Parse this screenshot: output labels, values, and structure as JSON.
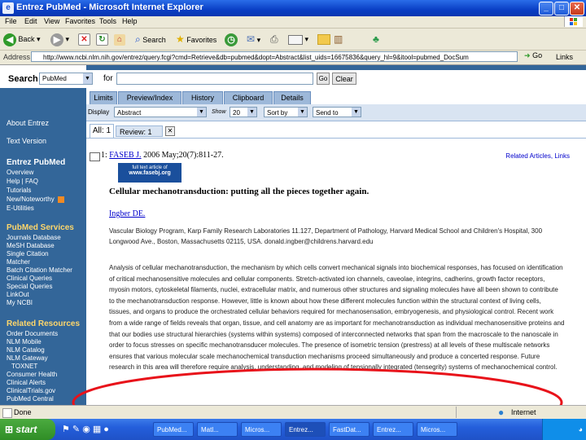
{
  "window": {
    "title": "Entrez PubMed - Microsoft Internet Explorer",
    "minimize": "_",
    "maximize": "□",
    "close": "✕"
  },
  "menu": [
    "File",
    "Edit",
    "View",
    "Favorites",
    "Tools",
    "Help"
  ],
  "toolbar": {
    "back": "Back",
    "search": "Search",
    "favorites": "Favorites"
  },
  "address": {
    "label": "Address",
    "url": "http://www.ncbi.nlm.nih.gov/entrez/query.fcgi?cmd=Retrieve&db=pubmed&dopt=Abstract&list_uids=16675836&query_hl=9&itool=pubmed_DocSum",
    "go": "Go",
    "links": "Links"
  },
  "search": {
    "label": "Search",
    "database": "PubMed",
    "for_label": "for",
    "go": "Go",
    "clear": "Clear"
  },
  "tabs": [
    "Limits",
    "Preview/Index",
    "History",
    "Clipboard",
    "Details"
  ],
  "controls": {
    "display_label": "Display",
    "display_value": "Abstract",
    "show_label": "Show",
    "show_value": "20",
    "sort_value": "Sort by",
    "send_value": "Send to"
  },
  "subtabs": {
    "all": "All: 1",
    "review": "Review: 1"
  },
  "sidebar": {
    "about": "About Entrez",
    "text_version": "Text Version",
    "entrez_pubmed_title": "Entrez PubMed",
    "entrez_items": [
      "Overview",
      "Help | FAQ",
      "Tutorials",
      "New/Noteworthy",
      "E-Utilities"
    ],
    "services_title": "PubMed Services",
    "services_items": [
      "Journals Database",
      "MeSH Database",
      "Single Citation",
      "Matcher",
      "Batch Citation Matcher",
      "Clinical Queries",
      "Special Queries",
      "LinkOut",
      "My NCBI"
    ],
    "resources_title": "Related Resources",
    "resources_items": [
      "Order Documents",
      "NLM Mobile",
      "NLM Catalog",
      "NLM Gateway",
      "TOXNET",
      "Consumer Health",
      "Clinical Alerts",
      "ClinicalTrials.gov",
      "PubMed Central"
    ]
  },
  "citation": {
    "number": "1:",
    "journal": "FASEB J.",
    "ref": "2006 May;20(7):811-27.",
    "related": "Related Articles, Links",
    "banner_line1": "full text article of",
    "banner_line2": "www.fasebj.org",
    "title": "Cellular mechanotransduction: putting all the pieces together again.",
    "author": "Ingber DE.",
    "affiliation": "Vascular Biology Program, Karp Family Research Laboratories 11.127, Department of Pathology, Harvard Medical School and Children's Hospital, 300 Longwood Ave., Boston, Massachusetts 02115, USA. donald.ingber@childrens.harvard.edu",
    "abstract": "Analysis of cellular mechanotransduction, the mechanism by which cells convert mechanical signals into biochemical responses, has focused on identification of critical mechanosensitive molecules and cellular components. Stretch-activated ion channels, caveolae, integrins, cadherins, growth factor receptors, myosin motors, cytoskeletal filaments, nuclei, extracellular matrix, and numerous other structures and signaling molecules have all been shown to contribute to the mechanotransduction response. However, little is known about how these different molecules function within the structural context of living cells, tissues, and organs to produce the orchestrated cellular behaviors required for mechanosensation, embryogenesis, and physiological control. Recent work from a wide range of fields reveals that organ, tissue, and cell anatomy are as important for mechanotransduction as individual mechanosensitive proteins and that our bodies use structural hierarchies (systems within systems) composed of interconnected networks that span from the macroscale to the nanoscale in order to focus stresses on specific mechanotransducer molecules. The presence of isometric tension (prestress) at all levels of these multiscale networks ensures that various molecular scale mechanochemical transduction mechanisms proceed simultaneously and produce a concerted response. Future research in this area will therefore require analysis, understanding, and modeling of tensionally integrated (tensegrity) systems of mechanochemical control."
  },
  "status": {
    "left": "Done",
    "zone": "Internet"
  },
  "taskbar": {
    "start": "start",
    "tasks": [
      "PubMed...",
      "Matl...",
      "Micros...",
      "Entrez...",
      "FastDat...",
      "Entrez...",
      "Micros..."
    ],
    "clock": ""
  },
  "colors": {
    "sidebar": "#336699",
    "annotation_ellipse": "#e8121a",
    "link": "#0000cc"
  }
}
